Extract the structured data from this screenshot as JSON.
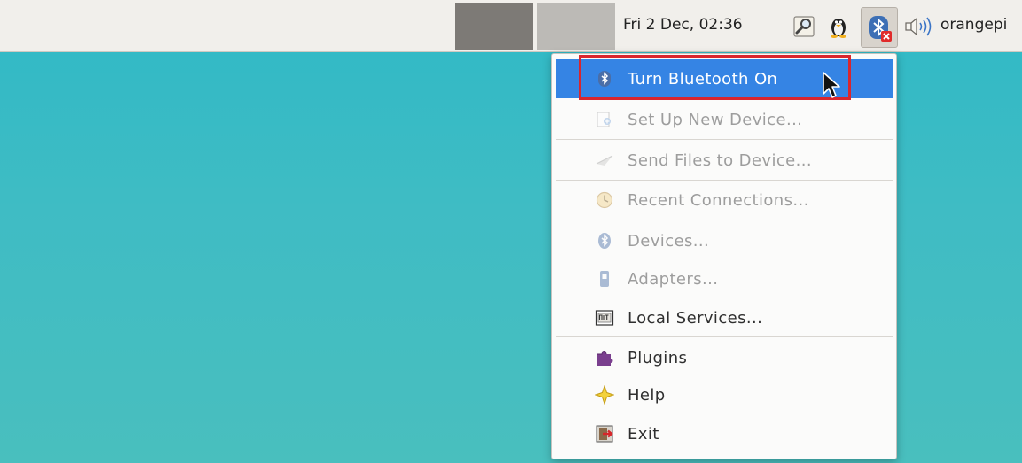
{
  "topbar": {
    "clock": "Fri  2 Dec, 02:36",
    "user": "orangepi",
    "icons": [
      "magnifier-icon",
      "tux-penguin-icon",
      "bluetooth-disabled-icon",
      "volume-icon"
    ]
  },
  "menu": {
    "items": [
      {
        "label": "Turn Bluetooth On",
        "icon": "bluetooth-icon",
        "enabled": true,
        "highlighted": true
      },
      {
        "label": "Set Up New Device...",
        "icon": "new-device-icon",
        "enabled": false
      },
      {
        "label": "Send Files to Device...",
        "icon": "send-files-icon",
        "enabled": false
      },
      {
        "label": "Recent Connections...",
        "icon": "recent-connections-icon",
        "enabled": false
      },
      {
        "label": "Devices...",
        "icon": "devices-icon",
        "enabled": false
      },
      {
        "label": "Adapters...",
        "icon": "adapters-icon",
        "enabled": false
      },
      {
        "label": "Local Services...",
        "icon": "local-services-icon",
        "enabled": true
      },
      {
        "label": "Plugins",
        "icon": "plugins-icon",
        "enabled": true
      },
      {
        "label": "Help",
        "icon": "help-icon",
        "enabled": true
      },
      {
        "label": "Exit",
        "icon": "exit-icon",
        "enabled": true
      }
    ]
  },
  "colors": {
    "desktop": "#3fbcc4",
    "highlight": "#3584e4",
    "annotation_frame": "#d9262e"
  }
}
